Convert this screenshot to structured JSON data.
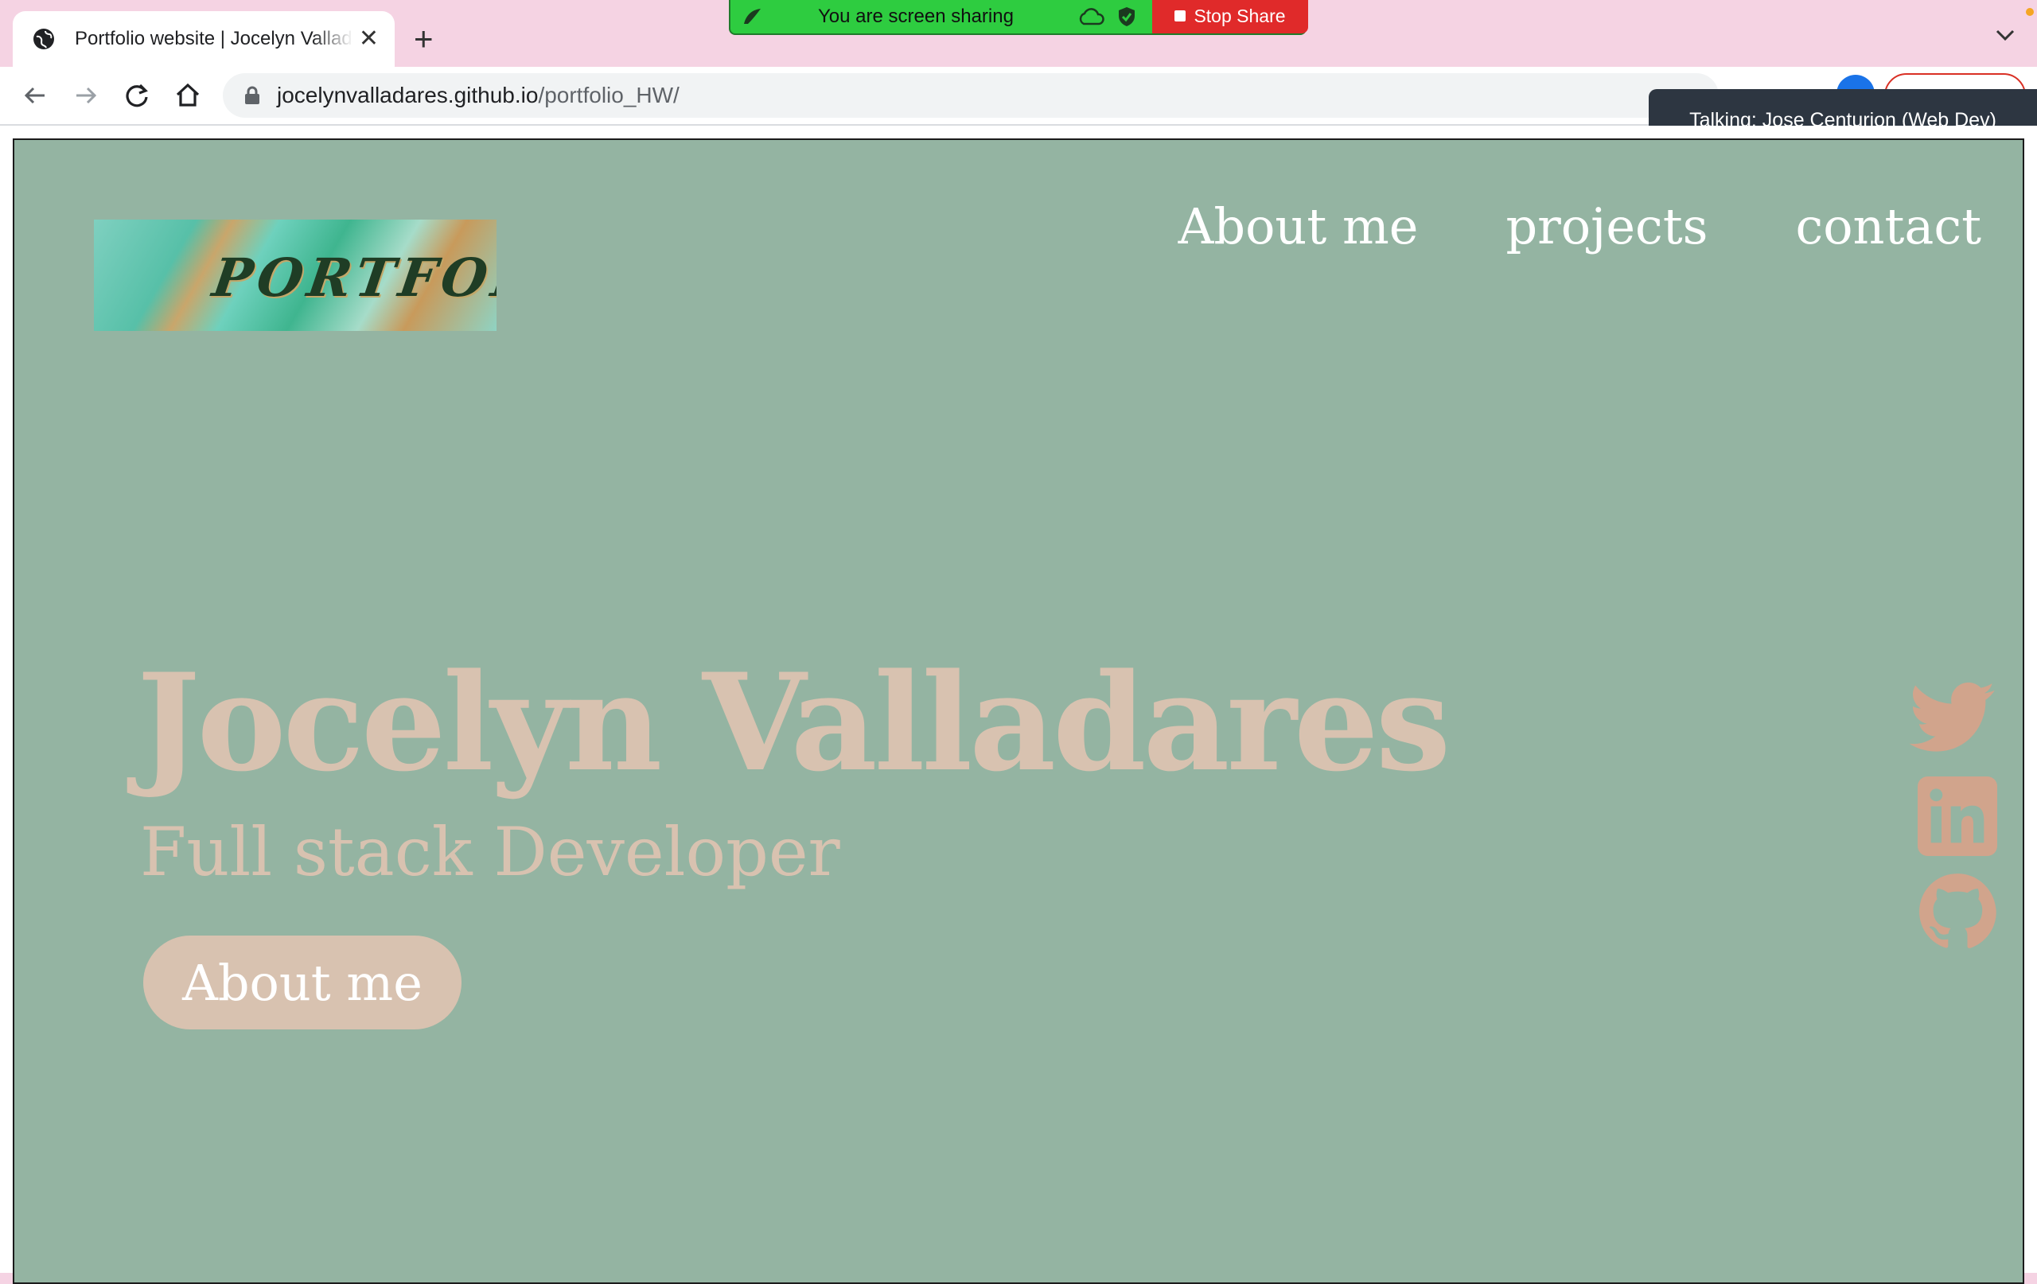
{
  "browser": {
    "tab_title": "Portfolio website | Jocelyn Valladares",
    "url_host": "jocelynvalladares.github.io",
    "url_path": "/portfolio_HW/"
  },
  "share_bar": {
    "status_text": "You are screen sharing",
    "stop_label": "Stop Share",
    "talking_text": "Talking: Jose Centurion (Web Dev)"
  },
  "site": {
    "logo_text": "PORTFOLIO",
    "nav": [
      "About me",
      "projects",
      "contact"
    ],
    "hero_name": "Jocelyn Valladares",
    "hero_role": "Full stack Developer",
    "cta_label": "About me",
    "social_icons": [
      "twitter-icon",
      "linkedin-icon",
      "github-icon"
    ]
  },
  "colors": {
    "page_bg": "#94b4a2",
    "hero_text": "#d8c2b0",
    "social_icon": "#d1a48c",
    "share_green": "#2ecc40",
    "stop_red": "#e02a2a"
  }
}
